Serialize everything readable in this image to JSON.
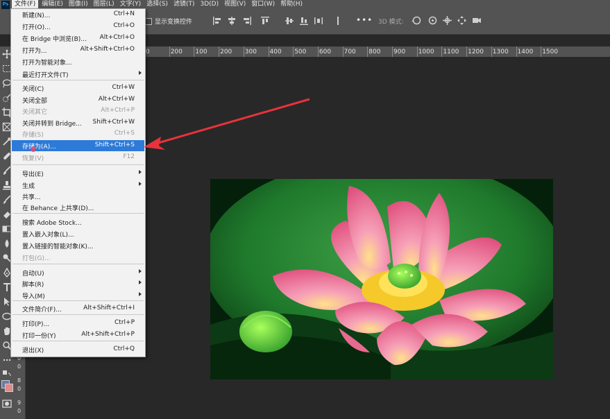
{
  "menubar": {
    "app_icon": "Ps",
    "items": [
      "文件(F)",
      "编辑(E)",
      "图像(I)",
      "图层(L)",
      "文字(Y)",
      "选择(S)",
      "滤镜(T)",
      "3D(D)",
      "视图(V)",
      "窗口(W)",
      "帮助(H)"
    ]
  },
  "options": {
    "show_transform_label": "显示变换控件",
    "more": "•••",
    "mode_3d_label": "3D 模式:"
  },
  "ruler": {
    "ticks": [
      "0",
      "200",
      "100",
      "200",
      "300",
      "400",
      "500",
      "600",
      "700",
      "800",
      "900",
      "1000",
      "1100",
      "1200",
      "1300",
      "1400",
      "1500"
    ]
  },
  "vruler": {
    "ticks": [
      "0",
      "0",
      "0",
      "8",
      "0",
      "9",
      "0"
    ]
  },
  "file_menu": {
    "items": [
      {
        "label": "新建(N)...",
        "shortcut": "Ctrl+N",
        "disabled": false
      },
      {
        "label": "打开(O)...",
        "shortcut": "Ctrl+O",
        "disabled": false
      },
      {
        "label": "在 Bridge 中浏览(B)...",
        "shortcut": "Alt+Ctrl+O",
        "disabled": false
      },
      {
        "label": "打开为...",
        "shortcut": "Alt+Shift+Ctrl+O",
        "disabled": false
      },
      {
        "label": "打开为智能对象...",
        "shortcut": "",
        "disabled": false
      },
      {
        "label": "最近打开文件(T)",
        "shortcut": "",
        "submenu": true,
        "disabled": false
      },
      {
        "label": "关闭(C)",
        "shortcut": "Ctrl+W",
        "disabled": false
      },
      {
        "label": "关闭全部",
        "shortcut": "Alt+Ctrl+W",
        "disabled": false
      },
      {
        "label": "关闭其它",
        "shortcut": "Alt+Ctrl+P",
        "disabled": true
      },
      {
        "label": "关闭并转到 Bridge...",
        "shortcut": "Shift+Ctrl+W",
        "disabled": false
      },
      {
        "label": "存储(S)",
        "shortcut": "Ctrl+S",
        "disabled": true
      },
      {
        "label": "存储为(A)...",
        "shortcut": "Shift+Ctrl+S",
        "disabled": false,
        "highlighted": true
      },
      {
        "label": "恢复(V)",
        "shortcut": "F12",
        "disabled": true
      },
      {
        "label": "导出(E)",
        "shortcut": "",
        "submenu": true,
        "disabled": false
      },
      {
        "label": "生成",
        "shortcut": "",
        "submenu": true,
        "disabled": false
      },
      {
        "label": "共享...",
        "shortcut": "",
        "disabled": false
      },
      {
        "label": "在 Behance 上共享(D)...",
        "shortcut": "",
        "disabled": false
      },
      {
        "label": "搜索 Adobe Stock...",
        "shortcut": "",
        "disabled": false
      },
      {
        "label": "置入嵌入对象(L)...",
        "shortcut": "",
        "disabled": false
      },
      {
        "label": "置入链接的智能对象(K)...",
        "shortcut": "",
        "disabled": false
      },
      {
        "label": "打包(G)...",
        "shortcut": "",
        "disabled": true
      },
      {
        "label": "自动(U)",
        "shortcut": "",
        "submenu": true,
        "disabled": false
      },
      {
        "label": "脚本(R)",
        "shortcut": "",
        "submenu": true,
        "disabled": false
      },
      {
        "label": "导入(M)",
        "shortcut": "",
        "submenu": true,
        "disabled": false
      },
      {
        "label": "文件简介(F)...",
        "shortcut": "Alt+Shift+Ctrl+I",
        "disabled": false
      },
      {
        "label": "打印(P)...",
        "shortcut": "Ctrl+P",
        "disabled": false
      },
      {
        "label": "打印一份(Y)",
        "shortcut": "Alt+Shift+Ctrl+P",
        "disabled": false
      },
      {
        "label": "退出(X)",
        "shortcut": "Ctrl+Q",
        "disabled": false
      }
    ]
  },
  "colors": {
    "menu_highlight": "#2d7ad8",
    "annotation_arrow": "#e8323c",
    "foreground_swatch": "#6a7aa8",
    "background_swatch": "#e08a8a"
  }
}
